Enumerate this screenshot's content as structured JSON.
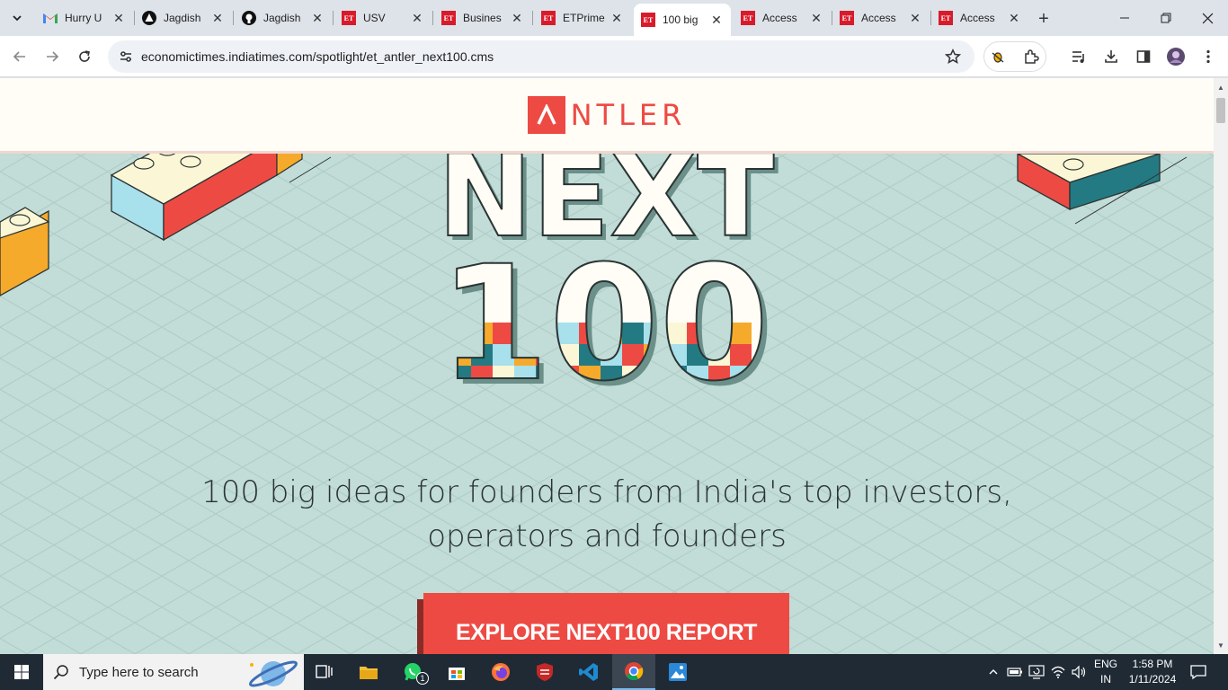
{
  "browser": {
    "tabs": [
      {
        "title": "Hurry U",
        "favicon": "gmail-icon"
      },
      {
        "title": "Jagdish",
        "favicon": "triangle-logo-icon"
      },
      {
        "title": "Jagdish",
        "favicon": "github-icon"
      },
      {
        "title": "USV",
        "favicon": "et-icon"
      },
      {
        "title": "Busines",
        "favicon": "et-icon"
      },
      {
        "title": "ETPrime",
        "favicon": "et-icon"
      },
      {
        "title": "100 big",
        "favicon": "et-icon",
        "active": true
      },
      {
        "title": "Access",
        "favicon": "et-icon"
      },
      {
        "title": "Access",
        "favicon": "et-icon"
      },
      {
        "title": "Access",
        "favicon": "et-icon"
      }
    ],
    "et_favicon_text": "ET",
    "url": "economictimes.indiatimes.com/spotlight/et_antler_next100.cms"
  },
  "page": {
    "logo_letter": "Λ",
    "logo_text": "NTLER",
    "hero_word1": "NEXT",
    "hero_word2": "100",
    "headline_line1": "100 big ideas for founders from India's top investors,",
    "headline_line2": "operators and founders",
    "cta_label": "EXPLORE NEXT100 REPORT",
    "colors": {
      "accent": "#ee4a44",
      "background": "#c2dcd7",
      "teal": "#247a82",
      "yellow": "#f6aa2c",
      "sky": "#a8e0ec"
    }
  },
  "taskbar": {
    "search_placeholder": "Type here to search",
    "whatsapp_badge": "1",
    "lang_line1": "ENG",
    "lang_line2": "IN",
    "time": "1:58 PM",
    "date": "1/11/2024"
  }
}
